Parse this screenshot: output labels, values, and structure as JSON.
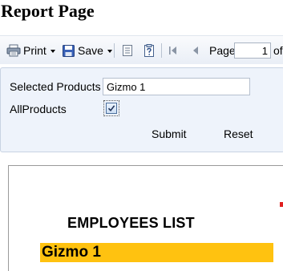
{
  "page": {
    "title": "Report Page"
  },
  "toolbar": {
    "print_label": "Print",
    "save_label": "Save",
    "page_label": "Page",
    "page_value": "1",
    "of_label": "of",
    "icons": {
      "print": "printer-icon",
      "save": "floppy-disk-icon",
      "document_map": "document-map-icon",
      "parameters": "parameters-icon",
      "first_page": "first-page-icon",
      "previous_page": "previous-page-icon"
    }
  },
  "parameters": {
    "selected_products_label": "Selected Products",
    "selected_products_value": "Gizmo 1",
    "all_products_label": "AllProducts",
    "all_products_checked": true,
    "submit_label": "Submit",
    "reset_label": "Reset"
  },
  "report": {
    "heading": "EMPLOYEES LIST",
    "group_title": "Gizmo 1",
    "colors": {
      "band": "#ffc210",
      "accent_mark": "#e02020"
    }
  }
}
